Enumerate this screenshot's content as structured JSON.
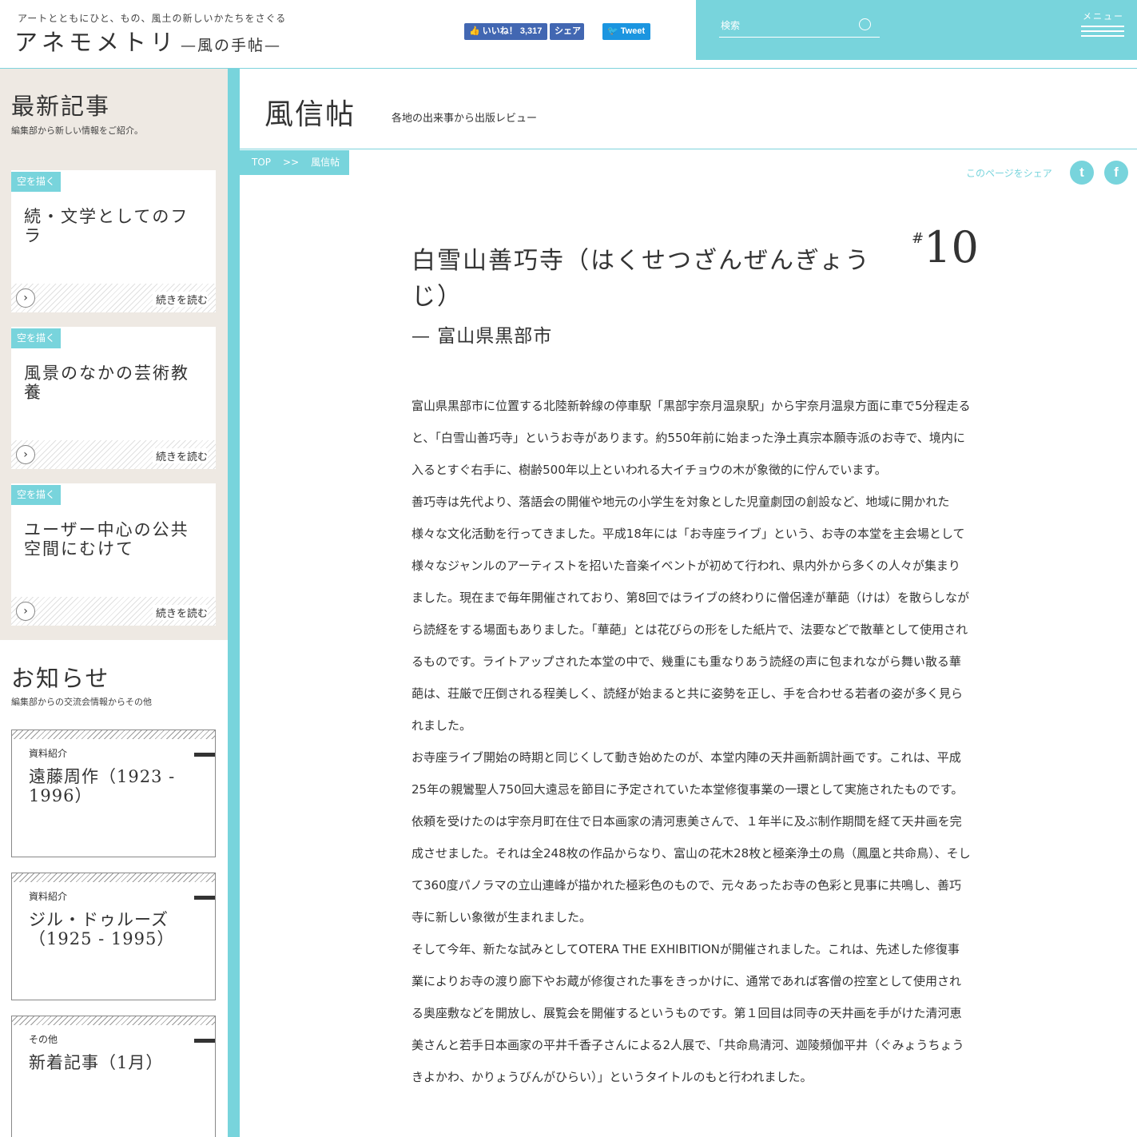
{
  "header": {
    "tagline": "アートとともにひと、もの、風土の新しいかたちをさぐる",
    "logo_main": "アネモメトリ",
    "logo_sub": "—風の手帖—",
    "fb_like": "いいね！ 3,317",
    "fb_share": "シェア",
    "tweet": "Tweet",
    "search_placeholder": "検索",
    "menu_label": "メニュー"
  },
  "sidebar": {
    "latest_title": "最新記事",
    "latest_sub": "編集部から新しい情報をご紹介。",
    "latest_items": [
      {
        "tag": "空を描く",
        "title": "続・文学としてのフラ",
        "read": "続きを読む"
      },
      {
        "tag": "空を描く",
        "title": "風景のなかの芸術教養",
        "read": "続きを読む"
      },
      {
        "tag": "空を描く",
        "title": "ユーザー中心の公共空間にむけて",
        "read": "続きを読む"
      }
    ],
    "notice_title": "お知らせ",
    "notice_sub": "編集部からの交流会情報からその他",
    "notice_items": [
      {
        "category": "資料紹介",
        "title": "遠藤周作（1923 - 1996）"
      },
      {
        "category": "資料紹介",
        "title": "ジル・ドゥルーズ（1925 - 1995）"
      },
      {
        "category": "その他",
        "title": "新着記事（1月）"
      }
    ]
  },
  "main": {
    "page_title": "風信帖",
    "page_sub": "各地の出来事から出版レビュー",
    "breadcrumb": [
      "TOP",
      ">>",
      "風信帖"
    ],
    "share_label": "このページをシェア",
    "article": {
      "title": "白雪山善巧寺（はくせつざんぜんぎょうじ）",
      "location": "— 富山県黒部市",
      "number_hash": "#",
      "number": "10",
      "paragraphs": [
        "富山県黒部市に位置する北陸新幹線の停車駅「黒部宇奈月温泉駅」から宇奈月温泉方面に車で5分程走ると、「白雪山善巧寺」というお寺があります。約550年前に始まった浄土真宗本願寺派のお寺で、境内に入るとすぐ右手に、樹齢500年以上といわれる大イチョウの木が象徴的に佇んでいます。",
        "善巧寺は先代より、落語会の開催や地元の小学生を対象とした児童劇団の創設など、地域に開かれた様々な文化活動を行ってきました。平成18年には「お寺座ライブ」という、お寺の本堂を主会場として様々なジャンルのアーティストを招いた音楽イベントが初めて行われ、県内外から多くの人々が集まりました。現在まで毎年開催されており、第8回ではライブの終わりに僧侶達が華葩（けは）を散らしながら読経をする場面もありました。「華葩」とは花びらの形をした紙片で、法要などで散華として使用されるものです。ライトアップされた本堂の中で、幾重にも重なりあう読経の声に包まれながら舞い散る華葩は、荘厳で圧倒される程美しく、読経が始まると共に姿勢を正し、手を合わせる若者の姿が多く見られました。",
        "お寺座ライブ開始の時期と同じくして動き始めたのが、本堂内陣の天井画新調計画です。これは、平成25年の親鸞聖人750回大遠忌を節目に予定されていた本堂修復事業の一環として実施されたものです。依頼を受けたのは宇奈月町在住で日本画家の清河恵美さんで、１年半に及ぶ制作期間を経て天井画を完成させました。それは全248枚の作品からなり、富山の花木28枚と極楽浄土の鳥（鳳凰と共命鳥）、そして360度パノラマの立山連峰が描かれた極彩色のもので、元々あったお寺の色彩と見事に共鳴し、善巧寺に新しい象徴が生まれました。",
        "そして今年、新たな試みとしてOTERA THE EXHIBITIONが開催されました。これは、先述した修復事業によりお寺の渡り廊下やお蔵が修復された事をきっかけに、通常であれば客僧の控室として使用される奥座敷などを開放し、展覧会を開催するというものです。第１回目は同寺の天井画を手がけた清河恵美さんと若手日本画家の平井千香子さんによる2人展で、「共命鳥清河、迦陵頻伽平井（ぐみょうちょうきよかわ、かりょうびんがひらい）」というタイトルのもと行われました。"
      ]
    }
  },
  "colors": {
    "accent": "#78d4dc",
    "sidebar_bg": "#eee9e3",
    "facebook": "#4267b2",
    "twitter": "#1b95e0"
  }
}
